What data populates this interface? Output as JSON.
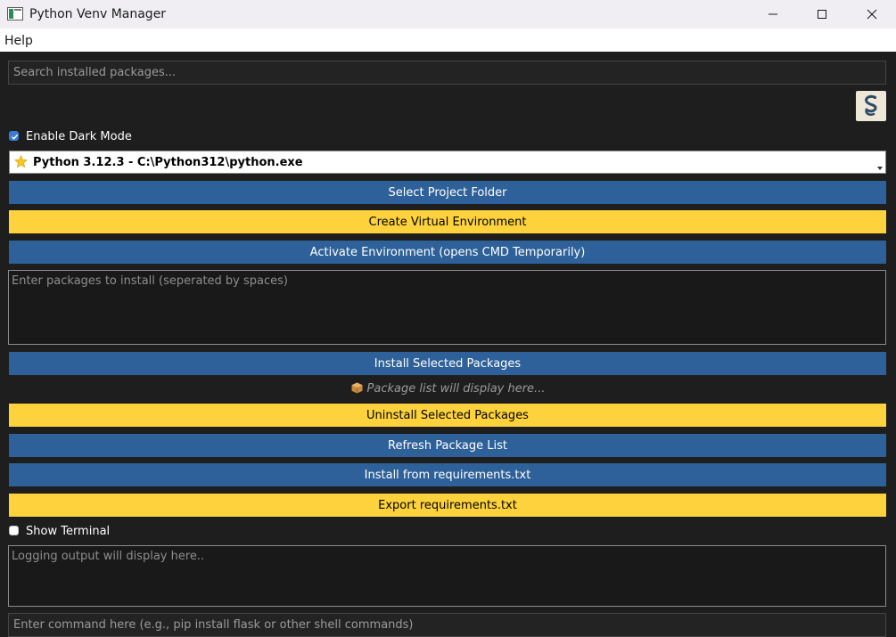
{
  "window": {
    "title": "Python Venv Manager",
    "icon": "app-window-icon",
    "controls": [
      "minimize-icon",
      "maximize-icon",
      "close-icon"
    ]
  },
  "menu": {
    "items": [
      "Help"
    ]
  },
  "search": {
    "placeholder": "Search installed packages..."
  },
  "logo": {
    "icon": "python-snake-logo-icon"
  },
  "dark_mode": {
    "label": "Enable Dark Mode",
    "checked": true
  },
  "interpreter": {
    "selected": "Python 3.12.3 - C:\\Python312\\python.exe",
    "icon": "star-icon"
  },
  "buttons": {
    "select_folder": "Select Project Folder",
    "create_venv": "Create Virtual Environment",
    "activate_env": "Activate Environment (opens CMD Temporarily)",
    "install_selected": "Install Selected Packages",
    "uninstall_selected": "Uninstall Selected Packages",
    "refresh_list": "Refresh Package List",
    "install_requirements": "Install from requirements.txt",
    "export_requirements": "Export requirements.txt"
  },
  "packages_input": {
    "placeholder": "Enter packages to install (seperated by spaces)"
  },
  "package_list": {
    "hint": "Package list will display here...",
    "icon": "package-icon"
  },
  "show_terminal": {
    "label": "Show Terminal",
    "checked": false
  },
  "log_output": {
    "placeholder": "Logging output will display here.."
  },
  "command_input": {
    "placeholder": "Enter command here (e.g., pip install flask or other shell commands)"
  },
  "colors": {
    "background": "#1e1e1e",
    "button_blue": "#2e6199",
    "button_yellow": "#fdd23c",
    "checkbox_accent": "#3a7bd5"
  }
}
